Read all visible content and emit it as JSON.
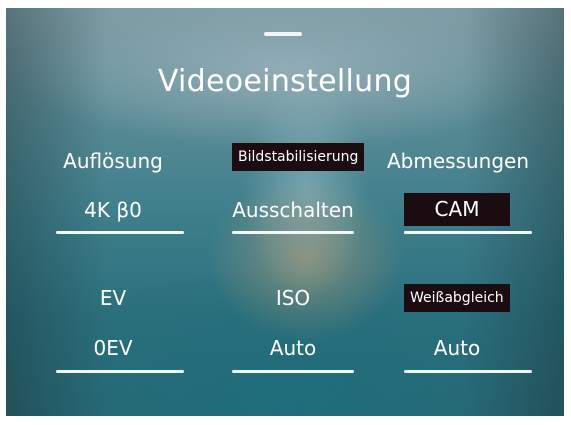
{
  "screen": {
    "title": "Videoeinstellung"
  },
  "settings": [
    {
      "label": "Auflösung",
      "value": "4K β0",
      "label_boxed": false,
      "value_boxed": false
    },
    {
      "label": "Bildstabilisierung",
      "value": "Ausschalten",
      "label_boxed": true,
      "value_boxed": false
    },
    {
      "label": "Abmessungen",
      "value": "CAM",
      "label_boxed": false,
      "value_boxed": true
    },
    {
      "label": "EV",
      "value": "0EV",
      "label_boxed": false,
      "value_boxed": false
    },
    {
      "label": "ISO",
      "value": "Auto",
      "label_boxed": false,
      "value_boxed": false
    },
    {
      "label": "Weißabgleich",
      "value": "Auto",
      "label_boxed": true,
      "value_boxed": false
    }
  ],
  "colors": {
    "text": "#ffffff",
    "highlight_box": "#1a0c10",
    "underline": "#f2f7f8"
  }
}
